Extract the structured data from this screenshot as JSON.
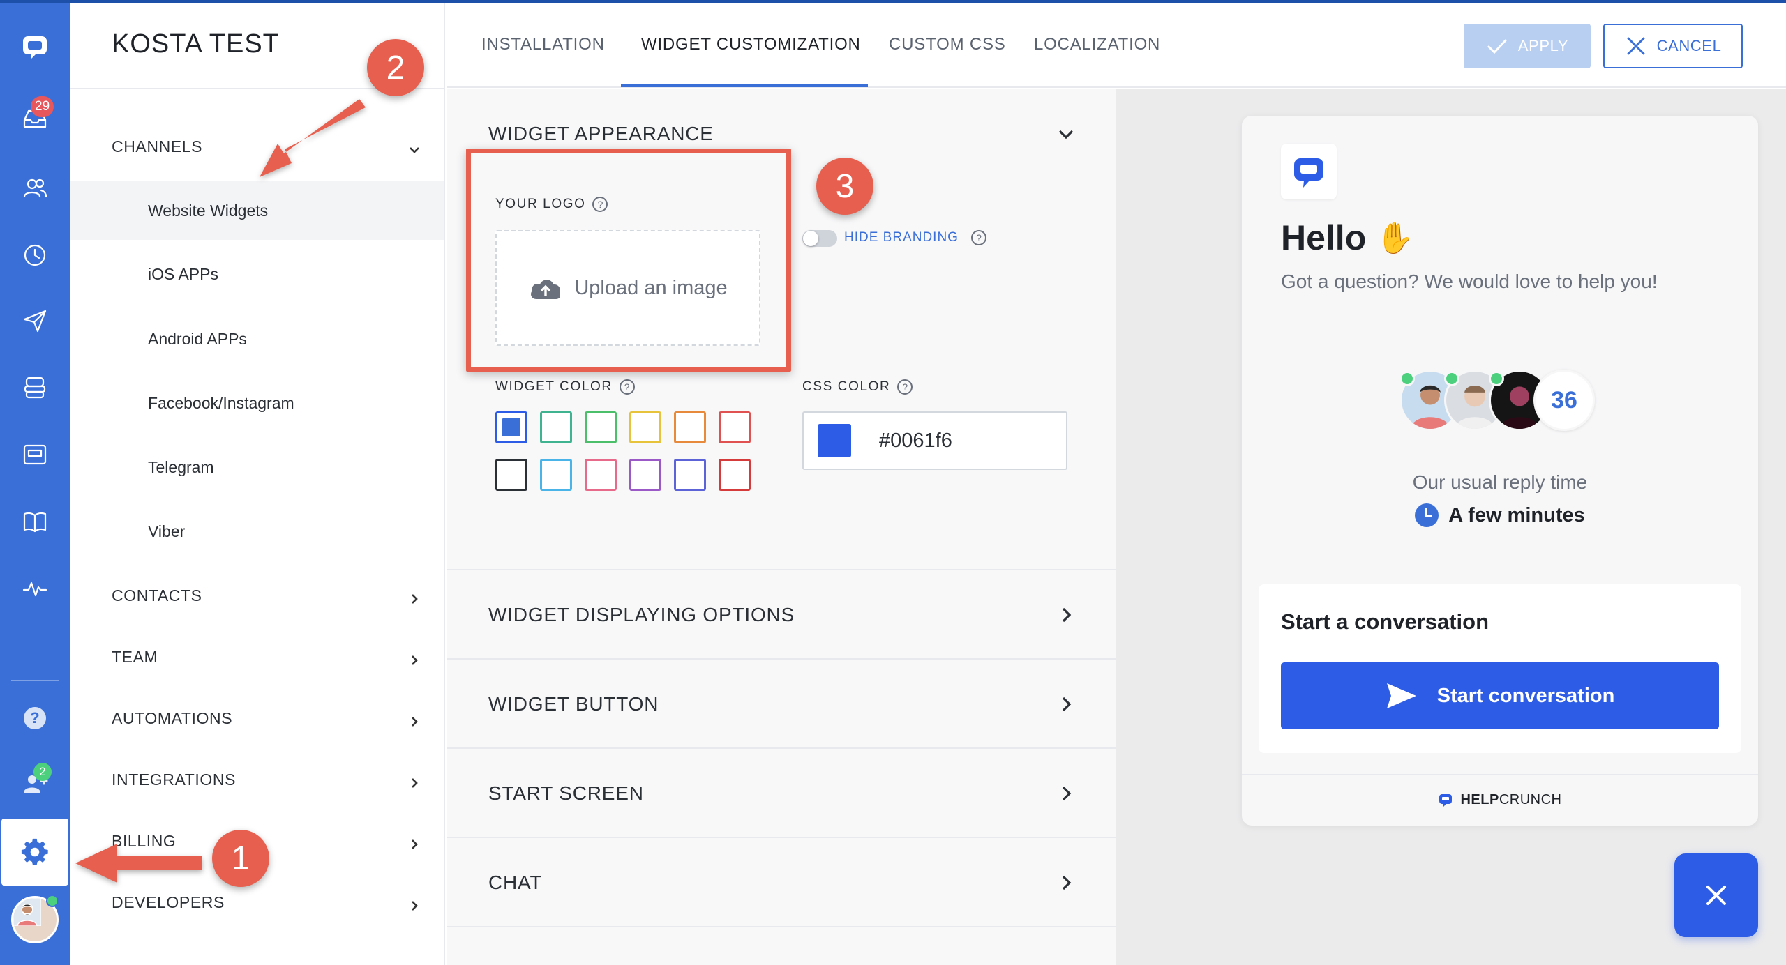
{
  "rail": {
    "inbox_badge": "29",
    "team_badge": "2",
    "colors": {
      "rail": "#3a6fd8",
      "badge_red": "#e8575b",
      "badge_green": "#4cd07d"
    }
  },
  "sidebar": {
    "app_title": "KOSTA TEST",
    "items": [
      {
        "label": "CHANNELS",
        "type": "category"
      },
      {
        "label": "Website Widgets",
        "type": "sub"
      },
      {
        "label": "iOS APPs",
        "type": "sub"
      },
      {
        "label": "Android APPs",
        "type": "sub"
      },
      {
        "label": "Facebook/Instagram",
        "type": "sub"
      },
      {
        "label": "Telegram",
        "type": "sub"
      },
      {
        "label": "Viber",
        "type": "sub"
      },
      {
        "label": "CONTACTS",
        "type": "category"
      },
      {
        "label": "TEAM",
        "type": "category"
      },
      {
        "label": "AUTOMATIONS",
        "type": "category"
      },
      {
        "label": "INTEGRATIONS",
        "type": "category"
      },
      {
        "label": "BILLING",
        "type": "category"
      },
      {
        "label": "DEVELOPERS",
        "type": "category"
      }
    ]
  },
  "header": {
    "tabs": [
      {
        "label": "INSTALLATION"
      },
      {
        "label": "WIDGET CUSTOMIZATION"
      },
      {
        "label": "CUSTOM CSS"
      },
      {
        "label": "LOCALIZATION"
      }
    ],
    "apply_label": "APPLY",
    "cancel_label": "CANCEL"
  },
  "settings": {
    "appearance_title": "WIDGET APPEARANCE",
    "logo_label": "YOUR LOGO",
    "upload_label": "Upload an image",
    "hide_branding_label": "HIDE BRANDING",
    "hide_branding_on": false,
    "widget_color_label": "WIDGET COLOR",
    "css_color_label": "CSS COLOR",
    "css_color_value": "#0061f6",
    "swatch_colors": [
      "#2d5ce6",
      "#3fb28f",
      "#4cbf6b",
      "#e6c33a",
      "#e88a3b",
      "#e05252",
      "#2b2f36",
      "#4ab3e8",
      "#e86a8a",
      "#9b59c8",
      "#5b63d6",
      "#d63b3b"
    ],
    "collapsed_sections": [
      "WIDGET DISPLAYING OPTIONS",
      "WIDGET BUTTON",
      "START SCREEN",
      "CHAT"
    ]
  },
  "preview": {
    "hello": "Hello",
    "hello_emoji": "✋",
    "subtitle": "Got a question? We would love to help you!",
    "team_count": "36",
    "reply_label": "Our usual reply time",
    "reply_value": "A few minutes",
    "conversation_title": "Start a conversation",
    "start_button": "Start conversation",
    "brand_bold": "HELP",
    "brand_rest": "CRUNCH",
    "accent": "#2d5ce6"
  },
  "annotations": {
    "step1": "1",
    "step2": "2",
    "step3": "3",
    "color": "#e7604f"
  }
}
